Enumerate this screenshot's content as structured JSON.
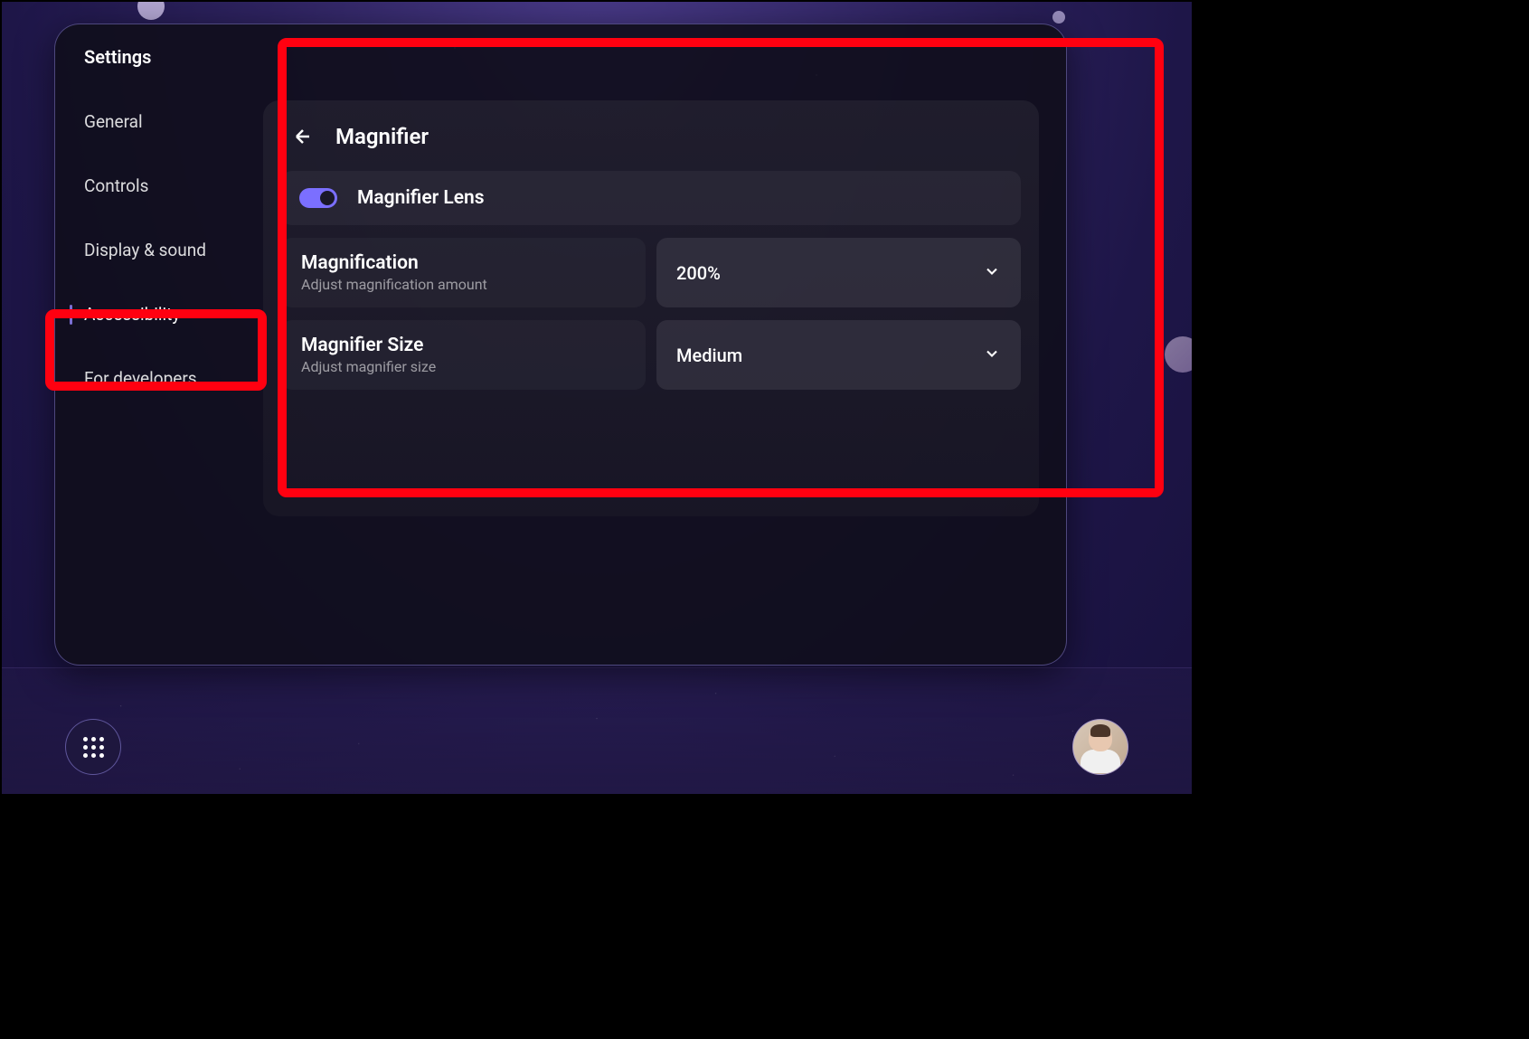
{
  "window": {
    "title": "Settings"
  },
  "sidebar": {
    "items": [
      {
        "label": "General",
        "active": false
      },
      {
        "label": "Controls",
        "active": false
      },
      {
        "label": "Display & sound",
        "active": false
      },
      {
        "label": "Accessibility",
        "active": true
      },
      {
        "label": "For developers",
        "active": false
      }
    ]
  },
  "panel": {
    "title": "Magnifier",
    "toggle": {
      "label": "Magnifier Lens",
      "enabled": true
    },
    "magnification": {
      "title": "Magnification",
      "description": "Adjust magnification amount",
      "value": "200%"
    },
    "size": {
      "title": "Magnifier Size",
      "description": "Adjust magnifier size",
      "value": "Medium"
    }
  },
  "highlights": {
    "panel_highlighted": true,
    "sidebar_item_highlighted": "Accessibility"
  },
  "colors": {
    "accent": "#7b6fff",
    "highlight": "#ff0010",
    "panel_bg": "#1c1a28"
  }
}
